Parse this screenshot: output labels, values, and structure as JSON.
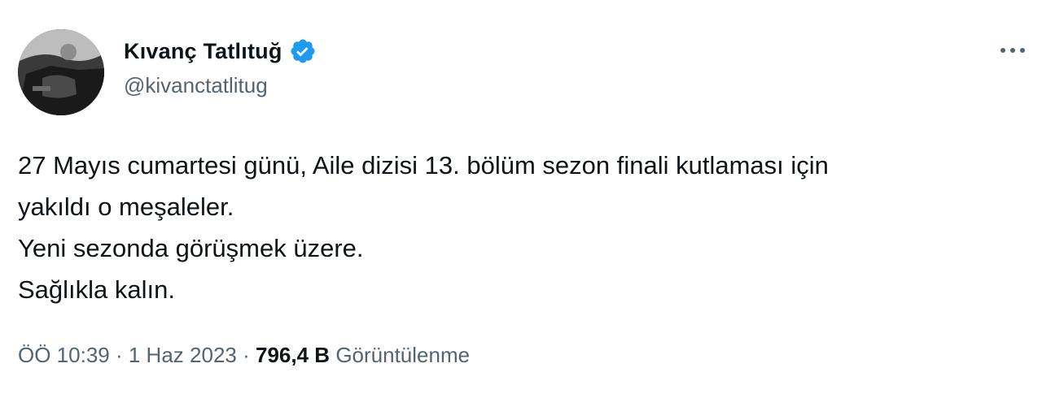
{
  "author": {
    "display_name": "Kıvanç Tatlıtuğ",
    "handle": "@kivanctatlitug",
    "verified": true,
    "verified_color": "#1d9bf0",
    "avatar_icon": "profile-photo"
  },
  "menu": {
    "more_icon": "more-horizontal-icon"
  },
  "tweet": {
    "lines": [
      "27 Mayıs cumartesi günü, Aile dizisi 13. bölüm sezon finali kutlaması için",
      "yakıldı o meşaleler.",
      "Yeni sezonda görüşmek üzere.",
      "Sağlıkla kalın."
    ]
  },
  "meta": {
    "time": "ÖÖ 10:39",
    "separator": "·",
    "date": "1 Haz 2023",
    "views_count": "796,4 B",
    "views_label": "Görüntülenme"
  },
  "colors": {
    "text_primary": "#0f1419",
    "text_secondary": "#536471",
    "background": "#ffffff"
  }
}
